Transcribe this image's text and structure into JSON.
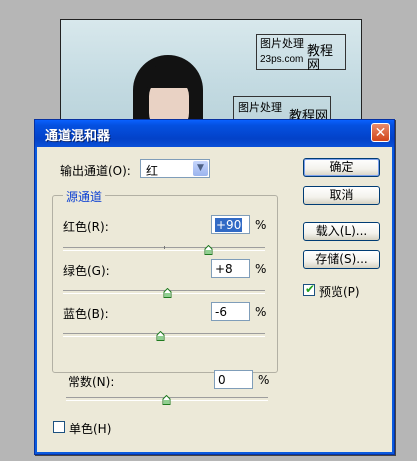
{
  "watermark": {
    "line1": "图片处理",
    "line2": "23ps.com",
    "big": "教程网"
  },
  "dialog": {
    "title": "通道混和器",
    "close_glyph": "✕",
    "output_channel": {
      "label": "输出通道(O):",
      "value": "红",
      "arrow": "▼"
    },
    "source_group": {
      "title": "源通道"
    },
    "channels": {
      "red": {
        "label": "红色(R):",
        "value": "+90",
        "percent": "%",
        "slider_value": 90
      },
      "green": {
        "label": "绿色(G):",
        "value": "+8",
        "percent": "%",
        "slider_value": 8
      },
      "blue": {
        "label": "蓝色(B):",
        "value": "-6",
        "percent": "%",
        "slider_value": -6
      }
    },
    "constant": {
      "label": "常数(N):",
      "value": "0",
      "percent": "%",
      "slider_value": 0
    },
    "monochrome": {
      "label": "单色(H)",
      "checked": false
    },
    "buttons": {
      "ok": "确定",
      "cancel": "取消",
      "load": "载入(L)...",
      "save": "存储(S)..."
    },
    "preview": {
      "label": "预览(P)",
      "checked": true,
      "check_glyph": "✔"
    }
  },
  "colors": {
    "title_bar": "#0450e0",
    "dialog_bg": "#ece9d8",
    "group_title": "#0a3fd3",
    "selection": "#316ac5"
  }
}
